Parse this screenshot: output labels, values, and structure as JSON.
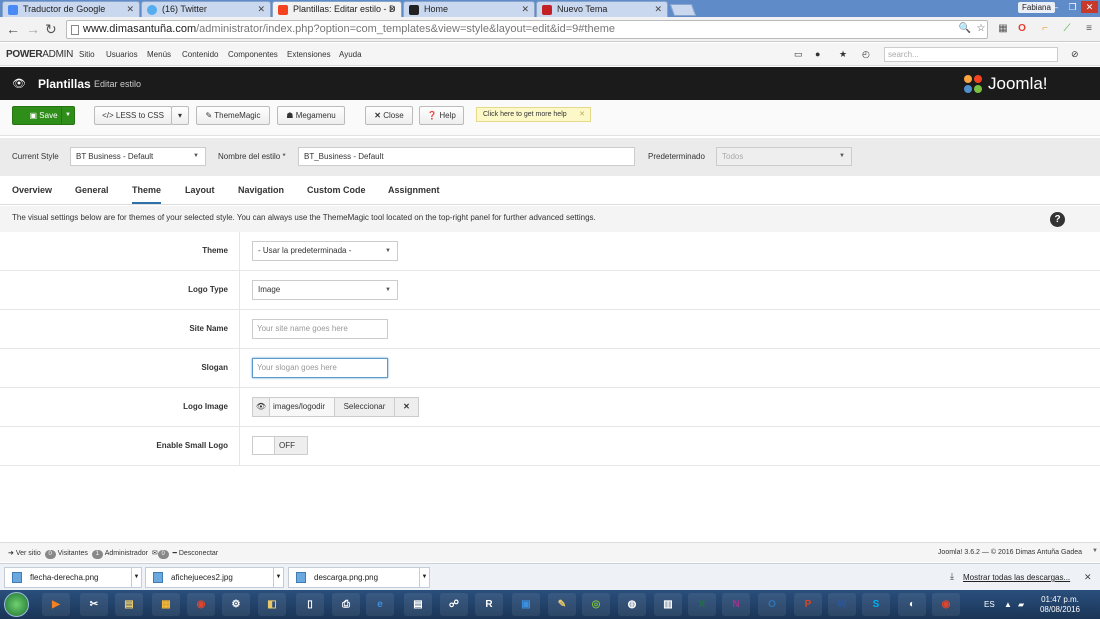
{
  "browser": {
    "tabs": [
      {
        "label": "Traductor de Google",
        "color": "#4a8af4"
      },
      {
        "label": "(16) Twitter",
        "color": "#55acee"
      },
      {
        "label": "Plantillas: Editar estilo - D",
        "color": "#f44321"
      },
      {
        "label": "Home",
        "color": "#222222"
      },
      {
        "label": "Nuevo Tema",
        "color": "#c32026"
      }
    ],
    "profile": "Fabiana",
    "url_host": "www.dimasantuña.com",
    "url_path": "/administrator/index.php?option=com_templates&view=style&layout=edit&id=9#theme"
  },
  "adminbar": {
    "brand_bold": "POWER",
    "brand_thin": "ADMIN",
    "menu": [
      "Sitio",
      "Usuarios",
      "Menús",
      "Contenido",
      "Componentes",
      "Extensiones",
      "Ayuda"
    ],
    "search_placeholder": "search..."
  },
  "header": {
    "title": "Plantillas",
    "subtitle": "Editar estilo",
    "logo": "Joomla!"
  },
  "toolbar": {
    "save": "Save",
    "less": "LESS to CSS",
    "thememagic": "ThemeMagic",
    "megamenu": "Megamenu",
    "close": "Close",
    "help": "Help",
    "help_tip": "Click here to get more help"
  },
  "style_bar": {
    "current_style_label": "Current Style",
    "current_style_value": "BT Business - Default",
    "style_name_label": "Nombre del estilo *",
    "style_name_value": "BT_Business - Default",
    "default_label": "Predeterminado",
    "default_value": "Todos"
  },
  "tabs": [
    "Overview",
    "General",
    "Theme",
    "Layout",
    "Navigation",
    "Custom Code",
    "Assignment"
  ],
  "active_tab": "Theme",
  "info": "The visual settings below are for themes of your selected style. You can always use the ThemeMagic tool located on the top-right panel for further advanced settings.",
  "form": {
    "theme_label": "Theme",
    "theme_value": "- Usar la predeterminada -",
    "logo_type_label": "Logo Type",
    "logo_type_value": "Image",
    "site_name_label": "Site Name",
    "site_name_placeholder": "Your site name goes here",
    "slogan_label": "Slogan",
    "slogan_placeholder": "Your slogan goes here",
    "logo_image_label": "Logo Image",
    "logo_image_value": "images/logodir",
    "logo_image_select": "Seleccionar",
    "small_logo_label": "Enable Small Logo",
    "small_logo_value": "OFF"
  },
  "statusbar": {
    "view_site": "Ver sitio",
    "visitors_count": "0",
    "visitors_label": "Visitantes",
    "admins_count": "1",
    "admins_label": "Administrador",
    "messages_count": "0",
    "logout": "Desconectar",
    "version": "Joomla! 3.6.2 — © 2016 Dimas Antuña Gadea"
  },
  "downloads": {
    "items": [
      "flecha-derecha.png",
      "afichejueces2.jpg",
      "descarga.png.png"
    ],
    "show_all": "Mostrar todas las descargas..."
  },
  "taskbar": {
    "lang": "ES",
    "time": "01:47 p.m.",
    "date": "08/08/2016"
  }
}
